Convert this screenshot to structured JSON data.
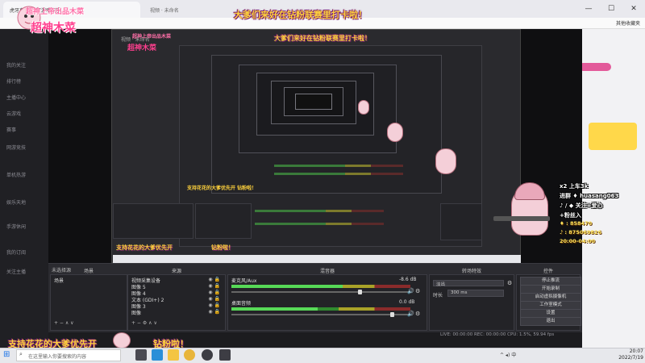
{
  "browser": {
    "tab_title": "虎牙直播_无限游戏娱乐",
    "tab2_title": "视频 · 未命名",
    "favorites_label": "其他收藏夹",
    "window_controls": [
      "—",
      "☐",
      "✕"
    ]
  },
  "sidebar": {
    "items": [
      {
        "label": "我的关注"
      },
      {
        "label": "排行榜"
      },
      {
        "label": "主播中心"
      },
      {
        "label": "云游戏"
      },
      {
        "label": "赛事"
      },
      {
        "label": "网游竞技"
      },
      {
        "label": "单机热游"
      },
      {
        "label": "娱乐天地"
      },
      {
        "label": "手游休闲"
      },
      {
        "label": "我的订阅"
      },
      {
        "label": "关注主播"
      }
    ]
  },
  "overlay": {
    "logo_line1": "超神上帝出品木菜",
    "logo_line2": "超神木菜",
    "banner_top": "大爹们来好在钻粉联赛里打卡啦！",
    "banner_bottom": "支持花花的大爹优先开",
    "banner_bottom_right": "钻粉啦！",
    "banner_mid_small": "支持花花的大爹优先开 钻粉啦！",
    "stats": [
      {
        "label": "x2 上车3k"
      },
      {
        "label": "进群 ♦ huasang063"
      },
      {
        "label": "♪ / ◆ 关注+爱心"
      },
      {
        "label": "+粉丝入"
      },
      {
        "label": "♦ : 858470"
      },
      {
        "label": "♪ : 875069826"
      },
      {
        "label": "20:00-04:00"
      }
    ]
  },
  "obs": {
    "scene_panel_title": "场景",
    "source_panel_title": "来源",
    "mixer_title": "混音器",
    "transition_title": "转场特效",
    "controls_title": "控件",
    "scene_header": "未选择源",
    "scenes": [
      "场景"
    ],
    "sources": [
      {
        "name": "视频采集设备",
        "type": "camera"
      },
      {
        "name": "图像 5",
        "type": "image"
      },
      {
        "name": "图像 4",
        "type": "image"
      },
      {
        "name": "文本 (GDI+) 2",
        "type": "text"
      },
      {
        "name": "图像 3",
        "type": "image"
      },
      {
        "name": "图像",
        "type": "image"
      }
    ],
    "mixer_tracks": [
      {
        "name": "麦克风/Aux",
        "db": "-8.6 dB",
        "level": 0.62,
        "fader": 0.72
      },
      {
        "name": "桌面音频",
        "db": "0.0 dB",
        "level": 0.48,
        "fader": 0.9
      }
    ],
    "transition": {
      "type": "淡出",
      "duration_label": "时长",
      "duration": "300 ms"
    },
    "controls": [
      "停止推流",
      "开始录制",
      "启动虚拟摄像机",
      "工作室模式",
      "设置",
      "退出"
    ],
    "status": "LIVE: 00:00:00   REC: 00:00:00   CPU: 1.5%, 59.94 fps"
  },
  "taskbar": {
    "search_placeholder": "在这里输入你要搜索的内容",
    "time": "20:07",
    "date": "2022/7/19",
    "tray": "^  ◂)  中"
  },
  "colors": {
    "overlay_yellow": "#ffd23c",
    "overlay_pink": "#ff3f8e",
    "obs_dark": "#2b2b30",
    "meter_green": "#2f8a2f"
  }
}
